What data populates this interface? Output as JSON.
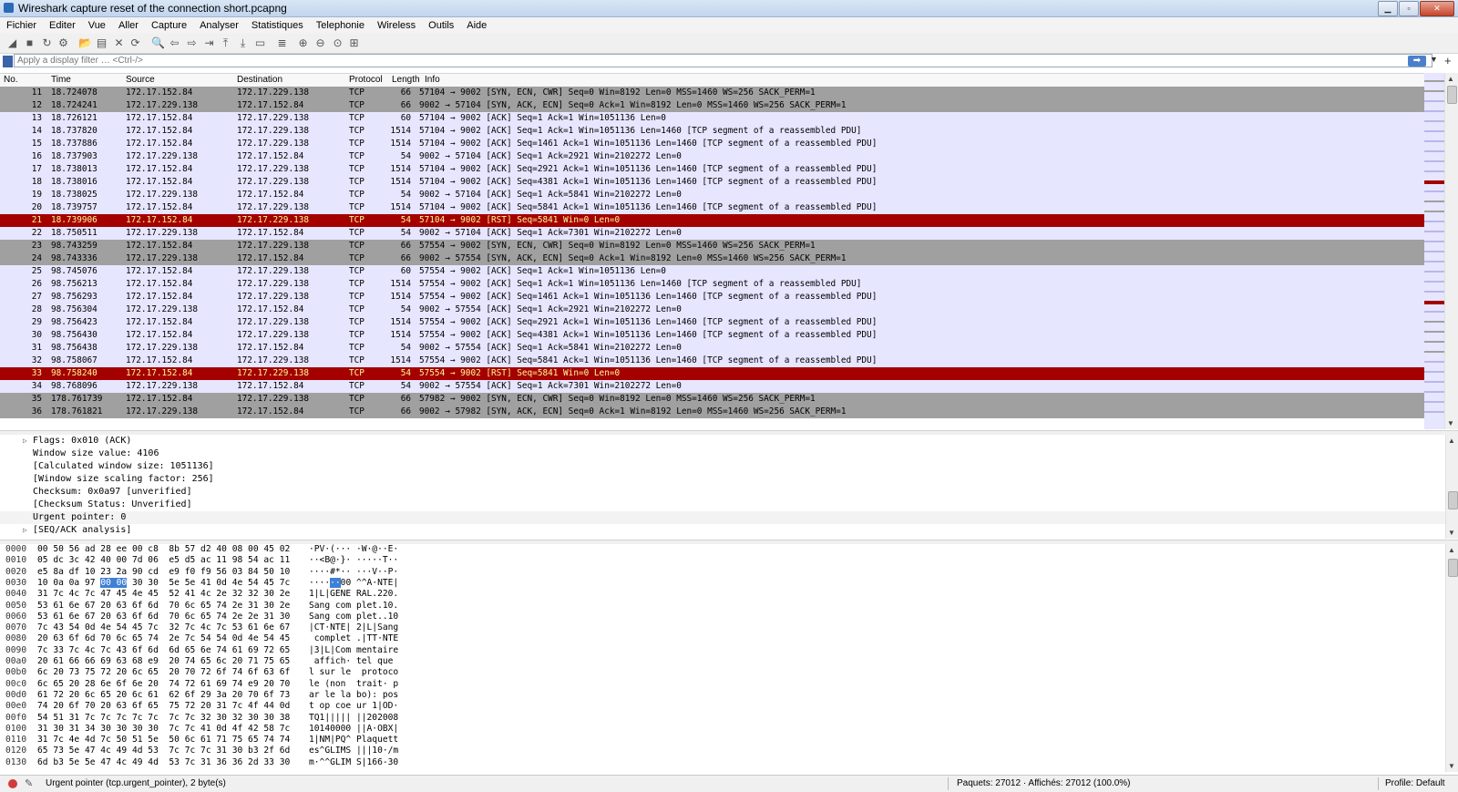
{
  "window": {
    "title": "Wireshark capture reset of the connection short.pcapng"
  },
  "menu": [
    "Fichier",
    "Editer",
    "Vue",
    "Aller",
    "Capture",
    "Analyser",
    "Statistiques",
    "Telephonie",
    "Wireless",
    "Outils",
    "Aide"
  ],
  "toolbar_icons": [
    "shark-fin-start-icon",
    "stop-icon",
    "restart-icon",
    "options-gear-icon",
    "open-folder-icon",
    "save-icon",
    "close-file-icon",
    "reload-icon",
    "find-icon",
    "back-arrow-icon",
    "forward-arrow-icon",
    "go-to-packet-icon",
    "first-packet-icon",
    "last-packet-icon",
    "autoscroll-icon",
    "colorize-icon",
    "zoom-in-icon",
    "zoom-out-icon",
    "zoom-normal-icon",
    "resize-columns-icon"
  ],
  "filter": {
    "placeholder": "Apply a display filter … <Ctrl-/>"
  },
  "columns": {
    "no": "No.",
    "time": "Time",
    "source": "Source",
    "destination": "Destination",
    "protocol": "Protocol",
    "length": "Length",
    "info": "Info"
  },
  "packets": [
    {
      "no": "11",
      "time": "18.724078",
      "src": "172.17.152.84",
      "dst": "172.17.229.138",
      "proto": "TCP",
      "len": "66",
      "info": "57104 → 9002 [SYN, ECN, CWR] Seq=0 Win=8192 Len=0 MSS=1460 WS=256 SACK_PERM=1",
      "style": "syn"
    },
    {
      "no": "12",
      "time": "18.724241",
      "src": "172.17.229.138",
      "dst": "172.17.152.84",
      "proto": "TCP",
      "len": "66",
      "info": "9002 → 57104 [SYN, ACK, ECN] Seq=0 Ack=1 Win=8192 Len=0 MSS=1460 WS=256 SACK_PERM=1",
      "style": "syn"
    },
    {
      "no": "13",
      "time": "18.726121",
      "src": "172.17.152.84",
      "dst": "172.17.229.138",
      "proto": "TCP",
      "len": "60",
      "info": "57104 → 9002 [ACK] Seq=1 Ack=1 Win=1051136 Len=0",
      "style": "tcp"
    },
    {
      "no": "14",
      "time": "18.737820",
      "src": "172.17.152.84",
      "dst": "172.17.229.138",
      "proto": "TCP",
      "len": "1514",
      "info": "57104 → 9002 [ACK] Seq=1 Ack=1 Win=1051136 Len=1460 [TCP segment of a reassembled PDU]",
      "style": "tcp"
    },
    {
      "no": "15",
      "time": "18.737886",
      "src": "172.17.152.84",
      "dst": "172.17.229.138",
      "proto": "TCP",
      "len": "1514",
      "info": "57104 → 9002 [ACK] Seq=1461 Ack=1 Win=1051136 Len=1460 [TCP segment of a reassembled PDU]",
      "style": "tcp"
    },
    {
      "no": "16",
      "time": "18.737903",
      "src": "172.17.229.138",
      "dst": "172.17.152.84",
      "proto": "TCP",
      "len": "54",
      "info": "9002 → 57104 [ACK] Seq=1 Ack=2921 Win=2102272 Len=0",
      "style": "tcp"
    },
    {
      "no": "17",
      "time": "18.738013",
      "src": "172.17.152.84",
      "dst": "172.17.229.138",
      "proto": "TCP",
      "len": "1514",
      "info": "57104 → 9002 [ACK] Seq=2921 Ack=1 Win=1051136 Len=1460 [TCP segment of a reassembled PDU]",
      "style": "tcp"
    },
    {
      "no": "18",
      "time": "18.738016",
      "src": "172.17.152.84",
      "dst": "172.17.229.138",
      "proto": "TCP",
      "len": "1514",
      "info": "57104 → 9002 [ACK] Seq=4381 Ack=1 Win=1051136 Len=1460 [TCP segment of a reassembled PDU]",
      "style": "tcp"
    },
    {
      "no": "19",
      "time": "18.738025",
      "src": "172.17.229.138",
      "dst": "172.17.152.84",
      "proto": "TCP",
      "len": "54",
      "info": "9002 → 57104 [ACK] Seq=1 Ack=5841 Win=2102272 Len=0",
      "style": "tcp"
    },
    {
      "no": "20",
      "time": "18.739757",
      "src": "172.17.152.84",
      "dst": "172.17.229.138",
      "proto": "TCP",
      "len": "1514",
      "info": "57104 → 9002 [ACK] Seq=5841 Ack=1 Win=1051136 Len=1460 [TCP segment of a reassembled PDU]",
      "style": "tcp"
    },
    {
      "no": "21",
      "time": "18.739906",
      "src": "172.17.152.84",
      "dst": "172.17.229.138",
      "proto": "TCP",
      "len": "54",
      "info": "57104 → 9002 [RST] Seq=5841 Win=0 Len=0",
      "style": "rst"
    },
    {
      "no": "22",
      "time": "18.750511",
      "src": "172.17.229.138",
      "dst": "172.17.152.84",
      "proto": "TCP",
      "len": "54",
      "info": "9002 → 57104 [ACK] Seq=1 Ack=7301 Win=2102272 Len=0",
      "style": "tcp"
    },
    {
      "no": "23",
      "time": "98.743259",
      "src": "172.17.152.84",
      "dst": "172.17.229.138",
      "proto": "TCP",
      "len": "66",
      "info": "57554 → 9002 [SYN, ECN, CWR] Seq=0 Win=8192 Len=0 MSS=1460 WS=256 SACK_PERM=1",
      "style": "syn"
    },
    {
      "no": "24",
      "time": "98.743336",
      "src": "172.17.229.138",
      "dst": "172.17.152.84",
      "proto": "TCP",
      "len": "66",
      "info": "9002 → 57554 [SYN, ACK, ECN] Seq=0 Ack=1 Win=8192 Len=0 MSS=1460 WS=256 SACK_PERM=1",
      "style": "syn"
    },
    {
      "no": "25",
      "time": "98.745076",
      "src": "172.17.152.84",
      "dst": "172.17.229.138",
      "proto": "TCP",
      "len": "60",
      "info": "57554 → 9002 [ACK] Seq=1 Ack=1 Win=1051136 Len=0",
      "style": "tcp"
    },
    {
      "no": "26",
      "time": "98.756213",
      "src": "172.17.152.84",
      "dst": "172.17.229.138",
      "proto": "TCP",
      "len": "1514",
      "info": "57554 → 9002 [ACK] Seq=1 Ack=1 Win=1051136 Len=1460 [TCP segment of a reassembled PDU]",
      "style": "tcp"
    },
    {
      "no": "27",
      "time": "98.756293",
      "src": "172.17.152.84",
      "dst": "172.17.229.138",
      "proto": "TCP",
      "len": "1514",
      "info": "57554 → 9002 [ACK] Seq=1461 Ack=1 Win=1051136 Len=1460 [TCP segment of a reassembled PDU]",
      "style": "tcp"
    },
    {
      "no": "28",
      "time": "98.756304",
      "src": "172.17.229.138",
      "dst": "172.17.152.84",
      "proto": "TCP",
      "len": "54",
      "info": "9002 → 57554 [ACK] Seq=1 Ack=2921 Win=2102272 Len=0",
      "style": "tcp"
    },
    {
      "no": "29",
      "time": "98.756423",
      "src": "172.17.152.84",
      "dst": "172.17.229.138",
      "proto": "TCP",
      "len": "1514",
      "info": "57554 → 9002 [ACK] Seq=2921 Ack=1 Win=1051136 Len=1460 [TCP segment of a reassembled PDU]",
      "style": "tcp"
    },
    {
      "no": "30",
      "time": "98.756430",
      "src": "172.17.152.84",
      "dst": "172.17.229.138",
      "proto": "TCP",
      "len": "1514",
      "info": "57554 → 9002 [ACK] Seq=4381 Ack=1 Win=1051136 Len=1460 [TCP segment of a reassembled PDU]",
      "style": "tcp"
    },
    {
      "no": "31",
      "time": "98.756438",
      "src": "172.17.229.138",
      "dst": "172.17.152.84",
      "proto": "TCP",
      "len": "54",
      "info": "9002 → 57554 [ACK] Seq=1 Ack=5841 Win=2102272 Len=0",
      "style": "tcp"
    },
    {
      "no": "32",
      "time": "98.758067",
      "src": "172.17.152.84",
      "dst": "172.17.229.138",
      "proto": "TCP",
      "len": "1514",
      "info": "57554 → 9002 [ACK] Seq=5841 Ack=1 Win=1051136 Len=1460 [TCP segment of a reassembled PDU]",
      "style": "tcp"
    },
    {
      "no": "33",
      "time": "98.758240",
      "src": "172.17.152.84",
      "dst": "172.17.229.138",
      "proto": "TCP",
      "len": "54",
      "info": "57554 → 9002 [RST] Seq=5841 Win=0 Len=0",
      "style": "rst"
    },
    {
      "no": "34",
      "time": "98.768096",
      "src": "172.17.229.138",
      "dst": "172.17.152.84",
      "proto": "TCP",
      "len": "54",
      "info": "9002 → 57554 [ACK] Seq=1 Ack=7301 Win=2102272 Len=0",
      "style": "tcp"
    },
    {
      "no": "35",
      "time": "178.761739",
      "src": "172.17.152.84",
      "dst": "172.17.229.138",
      "proto": "TCP",
      "len": "66",
      "info": "57982 → 9002 [SYN, ECN, CWR] Seq=0 Win=8192 Len=0 MSS=1460 WS=256 SACK_PERM=1",
      "style": "syn"
    },
    {
      "no": "36",
      "time": "178.761821",
      "src": "172.17.229.138",
      "dst": "172.17.152.84",
      "proto": "TCP",
      "len": "66",
      "info": "9002 → 57982 [SYN, ACK, ECN] Seq=0 Ack=1 Win=8192 Len=0 MSS=1460 WS=256 SACK_PERM=1",
      "style": "syn"
    }
  ],
  "details": [
    {
      "text": "Flags: 0x010 (ACK)",
      "expandable": true
    },
    {
      "text": "Window size value: 4106",
      "expandable": false
    },
    {
      "text": "[Calculated window size: 1051136]",
      "expandable": false
    },
    {
      "text": "[Window size scaling factor: 256]",
      "expandable": false
    },
    {
      "text": "Checksum: 0x0a97 [unverified]",
      "expandable": false
    },
    {
      "text": "[Checksum Status: Unverified]",
      "expandable": false
    },
    {
      "text": "Urgent pointer: 0",
      "expandable": false,
      "selected": true
    },
    {
      "text": "[SEQ/ACK analysis]",
      "expandable": true
    }
  ],
  "bytes": [
    {
      "off": "0000",
      "hex": "00 50 56 ad 28 ee 00 c8  8b 57 d2 40 08 00 45 02",
      "ascii": "·PV·(··· ·W·@··E·"
    },
    {
      "off": "0010",
      "hex": "05 dc 3c 42 40 00 7d 06  e5 d5 ac 11 98 54 ac 11",
      "ascii": "··<B@·}· ·····T··"
    },
    {
      "off": "0020",
      "hex": "e5 8a df 10 23 2a 90 cd  e9 f0 f9 56 03 84 50 10",
      "ascii": "····#*·· ···V··P·"
    },
    {
      "off": "0030",
      "hex_pre": "10 0a 0a 97 ",
      "hex_hl": "00 00",
      "hex_post": " 30 30  5e 5e 41 0d 4e 54 45 7c",
      "ascii_pre": "····",
      "ascii_hl": "··",
      "ascii_post": "00 ^^A·NTE|"
    },
    {
      "off": "0040",
      "hex": "31 7c 4c 7c 47 45 4e 45  52 41 4c 2e 32 32 30 2e",
      "ascii": "1|L|GENE RAL.220."
    },
    {
      "off": "0050",
      "hex": "53 61 6e 67 20 63 6f 6d  70 6c 65 74 2e 31 30 2e",
      "ascii": "Sang com plet.10."
    },
    {
      "off": "0060",
      "hex": "53 61 6e 67 20 63 6f 6d  70 6c 65 74 2e 2e 31 30",
      "ascii": "Sang com plet..10"
    },
    {
      "off": "0070",
      "hex": "7c 43 54 0d 4e 54 45 7c  32 7c 4c 7c 53 61 6e 67",
      "ascii": "|CT·NTE| 2|L|Sang"
    },
    {
      "off": "0080",
      "hex": "20 63 6f 6d 70 6c 65 74  2e 7c 54 54 0d 4e 54 45",
      "ascii": " complet .|TT·NTE"
    },
    {
      "off": "0090",
      "hex": "7c 33 7c 4c 7c 43 6f 6d  6d 65 6e 74 61 69 72 65",
      "ascii": "|3|L|Com mentaire"
    },
    {
      "off": "00a0",
      "hex": "20 61 66 66 69 63 68 e9  20 74 65 6c 20 71 75 65",
      "ascii": " affich· tel que"
    },
    {
      "off": "00b0",
      "hex": "6c 20 73 75 72 20 6c 65  20 70 72 6f 74 6f 63 6f",
      "ascii": "l sur le  protoco"
    },
    {
      "off": "00c0",
      "hex": "6c 65 20 28 6e 6f 6e 20  74 72 61 69 74 e9 20 70",
      "ascii": "le (non  trait· p"
    },
    {
      "off": "00d0",
      "hex": "61 72 20 6c 65 20 6c 61  62 6f 29 3a 20 70 6f 73",
      "ascii": "ar le la bo): pos"
    },
    {
      "off": "00e0",
      "hex": "74 20 6f 70 20 63 6f 65  75 72 20 31 7c 4f 44 0d",
      "ascii": "t op coe ur 1|OD·"
    },
    {
      "off": "00f0",
      "hex": "54 51 31 7c 7c 7c 7c 7c  7c 7c 32 30 32 30 30 38",
      "ascii": "TQ1||||| ||202008"
    },
    {
      "off": "0100",
      "hex": "31 30 31 34 30 30 30 30  7c 7c 41 0d 4f 42 58 7c",
      "ascii": "10140000 ||A·OBX|"
    },
    {
      "off": "0110",
      "hex": "31 7c 4e 4d 7c 50 51 5e  50 6c 61 71 75 65 74 74",
      "ascii": "1|NM|PQ^ Plaquett"
    },
    {
      "off": "0120",
      "hex": "65 73 5e 47 4c 49 4d 53  7c 7c 7c 31 30 b3 2f 6d",
      "ascii": "es^GLIMS |||10·/m"
    },
    {
      "off": "0130",
      "hex": "6d b3 5e 5e 47 4c 49 4d  53 7c 31 36 36 2d 33 30",
      "ascii": "m·^^GLIM S|166-30"
    }
  ],
  "status": {
    "field": "Urgent pointer (tcp.urgent_pointer), 2 byte(s)",
    "packets": "Paquets: 27012 · Affichés: 27012 (100.0%)",
    "profile": "Profile: Default"
  },
  "colors": {
    "syn": "#a0a0a0",
    "tcp": "#e7e6ff",
    "rst": "#a40000",
    "rst_text": "#fffc9c"
  }
}
